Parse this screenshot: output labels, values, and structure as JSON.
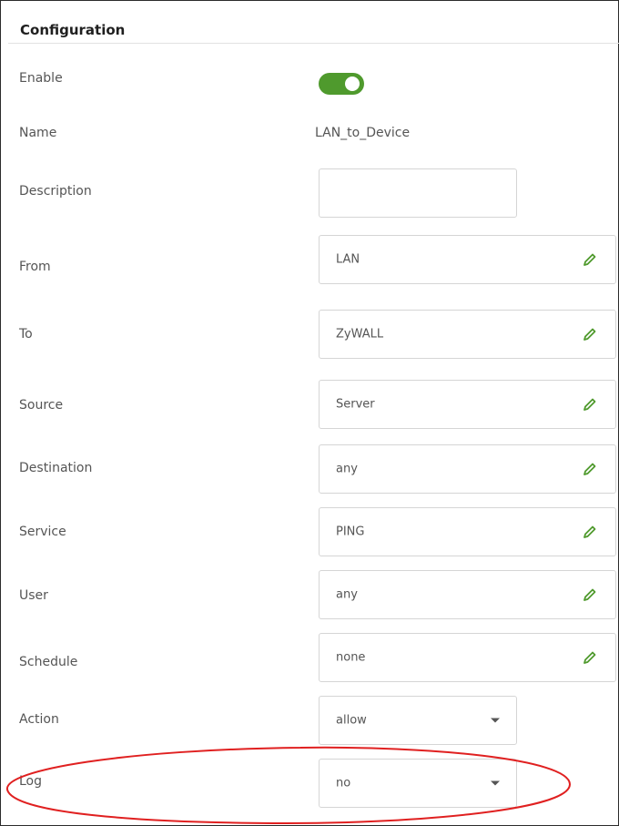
{
  "section": {
    "title": "Configuration"
  },
  "enable": {
    "label": "Enable",
    "state": "on",
    "color": "#4f9a2d"
  },
  "name": {
    "label": "Name",
    "value": "LAN_to_Device"
  },
  "description": {
    "label": "Description",
    "value": ""
  },
  "from": {
    "label": "From",
    "value": "LAN",
    "icon": "edit-icon"
  },
  "to": {
    "label": "To",
    "value": "ZyWALL",
    "icon": "edit-icon"
  },
  "source": {
    "label": "Source",
    "value": "Server",
    "icon": "edit-icon"
  },
  "destination": {
    "label": "Destination",
    "value": "any",
    "icon": "edit-icon"
  },
  "service": {
    "label": "Service",
    "value": "PING",
    "icon": "edit-icon"
  },
  "user": {
    "label": "User",
    "value": "any",
    "icon": "edit-icon"
  },
  "schedule": {
    "label": "Schedule",
    "value": "none",
    "icon": "edit-icon"
  },
  "action": {
    "label": "Action",
    "value": "allow",
    "icon": "chevron-down-icon"
  },
  "log": {
    "label": "Log",
    "value": "no",
    "icon": "chevron-down-icon"
  },
  "colors": {
    "accent": "#4f9a2d",
    "annotation": "#e02020"
  }
}
